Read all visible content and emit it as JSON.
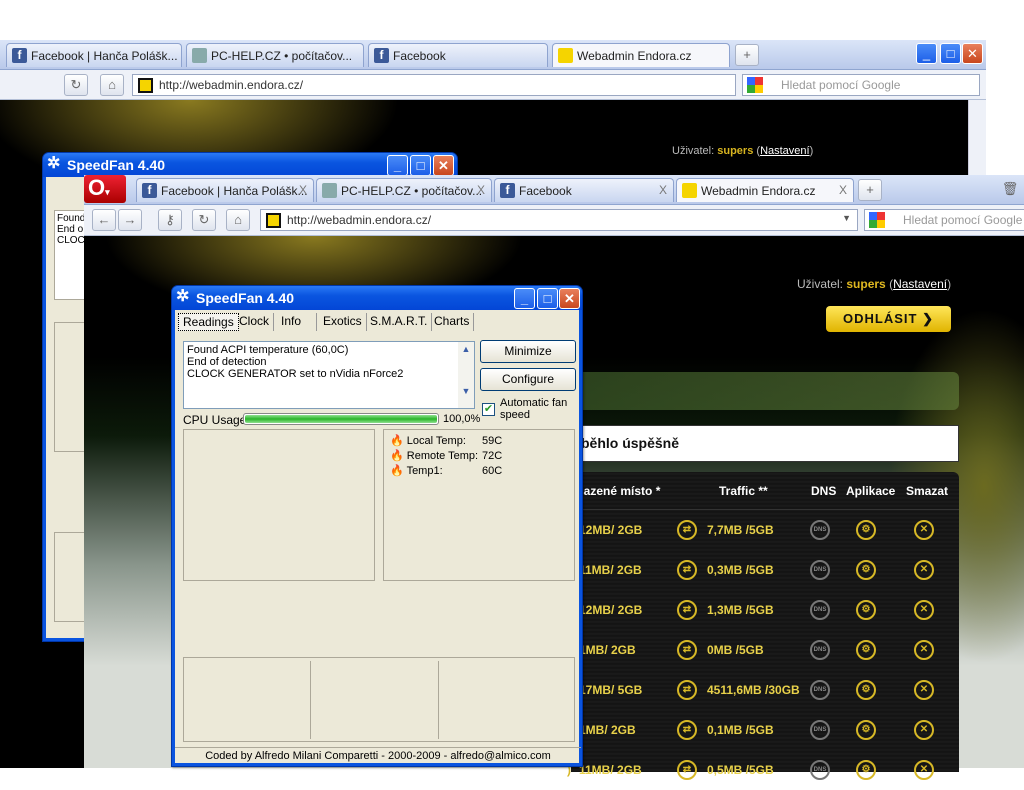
{
  "back_browser": {
    "tabs": [
      {
        "label": "Facebook | Hanča Polášk...",
        "icon": "facebook-icon"
      },
      {
        "label": "PC-HELP.CZ • počítačov...",
        "icon": "computer-icon"
      },
      {
        "label": "Facebook",
        "icon": "facebook-icon"
      },
      {
        "label": "Webadmin Endora.cz",
        "icon": "endora-icon"
      }
    ],
    "url": "http://webadmin.endora.cz/",
    "search_placeholder": "Hledat pomocí Google",
    "user_label": "Uživatel:",
    "user_name": "supers",
    "settings_link": "Nastavení"
  },
  "back_speedfan": {
    "title": "SpeedFan 4.40",
    "log": [
      "Found",
      "End o",
      "CLOC"
    ]
  },
  "front_browser": {
    "tabs": [
      {
        "label": "Facebook | Hanča Polášk...",
        "icon": "facebook-icon"
      },
      {
        "label": "PC-HELP.CZ • počítačov...",
        "icon": "computer-icon"
      },
      {
        "label": "Facebook",
        "icon": "facebook-icon"
      },
      {
        "label": "Webadmin Endora.cz",
        "icon": "endora-icon"
      }
    ],
    "url": "http://webadmin.endora.cz/",
    "search_placeholder": "Hledat pomocí Google",
    "user_label": "Uživatel:",
    "user_name": "supers",
    "settings_open": "(",
    "settings_link": "Nastavení",
    "settings_close": ")",
    "logout": "ODHLÁSIT",
    "success_message": "běhlo úspěšně",
    "table": {
      "headers": [
        "sazené místo *",
        "Traffic **",
        "DNS",
        "Aplikace",
        "Smazat"
      ],
      "rows": [
        {
          "space": "12MB/ 2GB",
          "traffic": "7,7MB /5GB"
        },
        {
          "space": "11MB/ 2GB",
          "traffic": "0,3MB /5GB"
        },
        {
          "space": "12MB/ 2GB",
          "traffic": "1,3MB /5GB"
        },
        {
          "space": "1MB/ 2GB",
          "traffic": "0MB /5GB"
        },
        {
          "space": "17MB/ 5GB",
          "traffic": "4511,6MB /30GB"
        },
        {
          "space": "1MB/ 2GB",
          "traffic": "0,1MB /5GB"
        },
        {
          "space": "11MB/ 2GB",
          "traffic": "0,5MB /5GB"
        }
      ]
    }
  },
  "speedfan": {
    "title": "SpeedFan 4.40",
    "tabs": [
      "Readings",
      "Clock",
      "Info",
      "Exotics",
      "S.M.A.R.T.",
      "Charts"
    ],
    "log": [
      "Found ACPI temperature (60,0C)",
      "End of detection",
      "CLOCK GENERATOR set to nVidia nForce2"
    ],
    "minimize": "Minimize",
    "configure": "Configure",
    "auto_fan": "Automatic fan speed",
    "auto_fan_checked": true,
    "cpu_label": "CPU Usage",
    "cpu_value": "100,0%",
    "cpu_fraction": 1.0,
    "temps": [
      {
        "label": "Local Temp:",
        "value": "59C"
      },
      {
        "label": "Remote Temp:",
        "value": "72C"
      },
      {
        "label": "Temp1:",
        "value": "60C"
      }
    ],
    "footer": "Coded by Alfredo Milani Comparetti - 2000-2009 - alfredo@almico.com"
  }
}
